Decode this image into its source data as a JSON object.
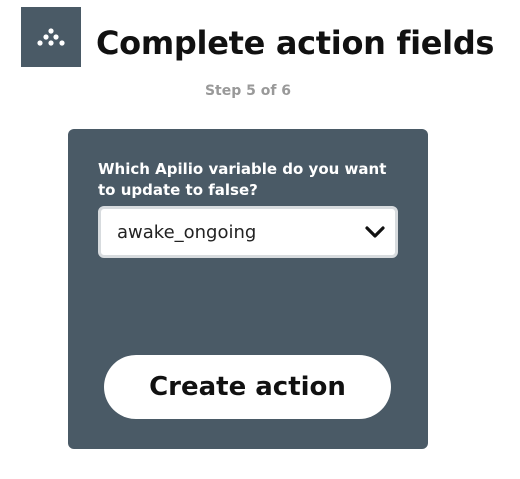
{
  "header": {
    "logo_icon": "apilio-dots-icon",
    "logo_bg_color": "#4a5a66",
    "title": "Complete action fields",
    "step": "Step 5 of 6"
  },
  "card": {
    "bg_color": "#4a5a66",
    "field_label": "Which Apilio variable do you want to update to false?",
    "select": {
      "selected_value": "awake_ongoing",
      "icon": "chevron-down-icon"
    },
    "button_label": "Create action"
  }
}
